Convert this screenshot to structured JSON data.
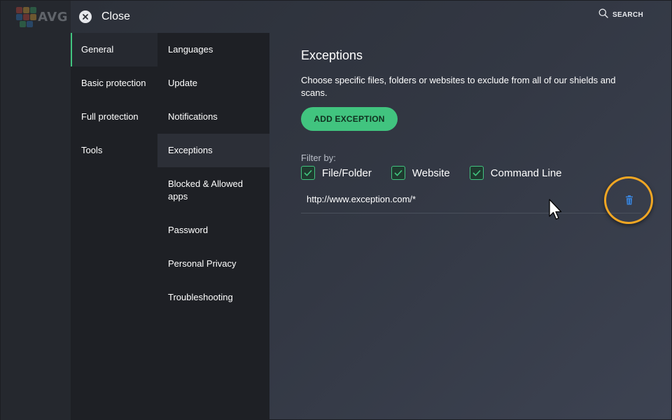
{
  "brand": {
    "logo_text": "AVG",
    "accent": "#41c47f"
  },
  "topbar": {
    "close_label": "Close",
    "search_label": "SEARCH"
  },
  "nav_primary": [
    {
      "label": "General",
      "active": true
    },
    {
      "label": "Basic protection",
      "active": false
    },
    {
      "label": "Full protection",
      "active": false
    },
    {
      "label": "Tools",
      "active": false
    }
  ],
  "nav_secondary": [
    {
      "label": "Languages",
      "active": false
    },
    {
      "label": "Update",
      "active": false
    },
    {
      "label": "Notifications",
      "active": false
    },
    {
      "label": "Exceptions",
      "active": true
    },
    {
      "label": "Blocked & Allowed apps",
      "active": false
    },
    {
      "label": "Password",
      "active": false
    },
    {
      "label": "Personal Privacy",
      "active": false
    },
    {
      "label": "Troubleshooting",
      "active": false
    }
  ],
  "main": {
    "title": "Exceptions",
    "description": "Choose specific files, folders or websites to exclude from all of our shields and scans.",
    "add_button": "ADD EXCEPTION",
    "filter_label": "Filter by:",
    "filters": [
      {
        "label": "File/Folder",
        "checked": true
      },
      {
        "label": "Website",
        "checked": true
      },
      {
        "label": "Command Line",
        "checked": true
      }
    ],
    "exceptions": [
      {
        "value": "http://www.exception.com/*",
        "icon": "trash-icon"
      }
    ]
  },
  "colors": {
    "highlight": "#f0a623",
    "trash": "#3b82d6"
  }
}
